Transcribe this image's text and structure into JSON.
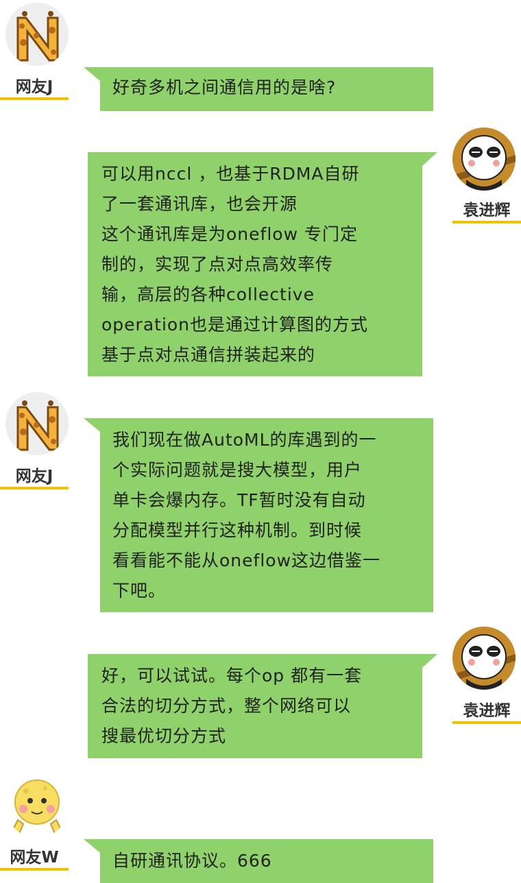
{
  "messages": [
    {
      "sender": "网友J",
      "avatar": "giraffe-n-icon",
      "side": "left",
      "lines": [
        "好奇多机之间通信用的是啥?"
      ]
    },
    {
      "sender": "袁进辉",
      "avatar": "panda-icon",
      "side": "right",
      "lines": [
        "可以用nccl ，也基于RDMA自研",
        "了一套通讯库，也会开源",
        "这个通讯库是为oneflow 专门定",
        "制的，实现了点对点高效率传",
        "输，高层的各种collective",
        "operation也是通过计算图的方式",
        "基于点对点通信拼装起来的"
      ]
    },
    {
      "sender": "网友J",
      "avatar": "giraffe-n-icon",
      "side": "left",
      "lines": [
        "我们现在做AutoML的库遇到的一",
        "个实际问题就是搜大模型，用户",
        "单卡会爆内存。TF暂时没有自动",
        "分配模型并行这种机制。到时候",
        "看看能不能从oneflow这边借鉴一",
        "下吧。"
      ]
    },
    {
      "sender": "袁进辉",
      "avatar": "panda-icon",
      "side": "right",
      "lines": [
        "好，可以试试。每个op 都有一套",
        "合法的切分方式，整个网络可以",
        "搜最优切分方式"
      ]
    },
    {
      "sender": "网友W",
      "avatar": "moon-emoji-icon",
      "side": "left",
      "lines": [
        "自研通讯协议。666"
      ]
    }
  ],
  "colors": {
    "bubble": "#8fd16a",
    "underline": "#f2c200"
  }
}
